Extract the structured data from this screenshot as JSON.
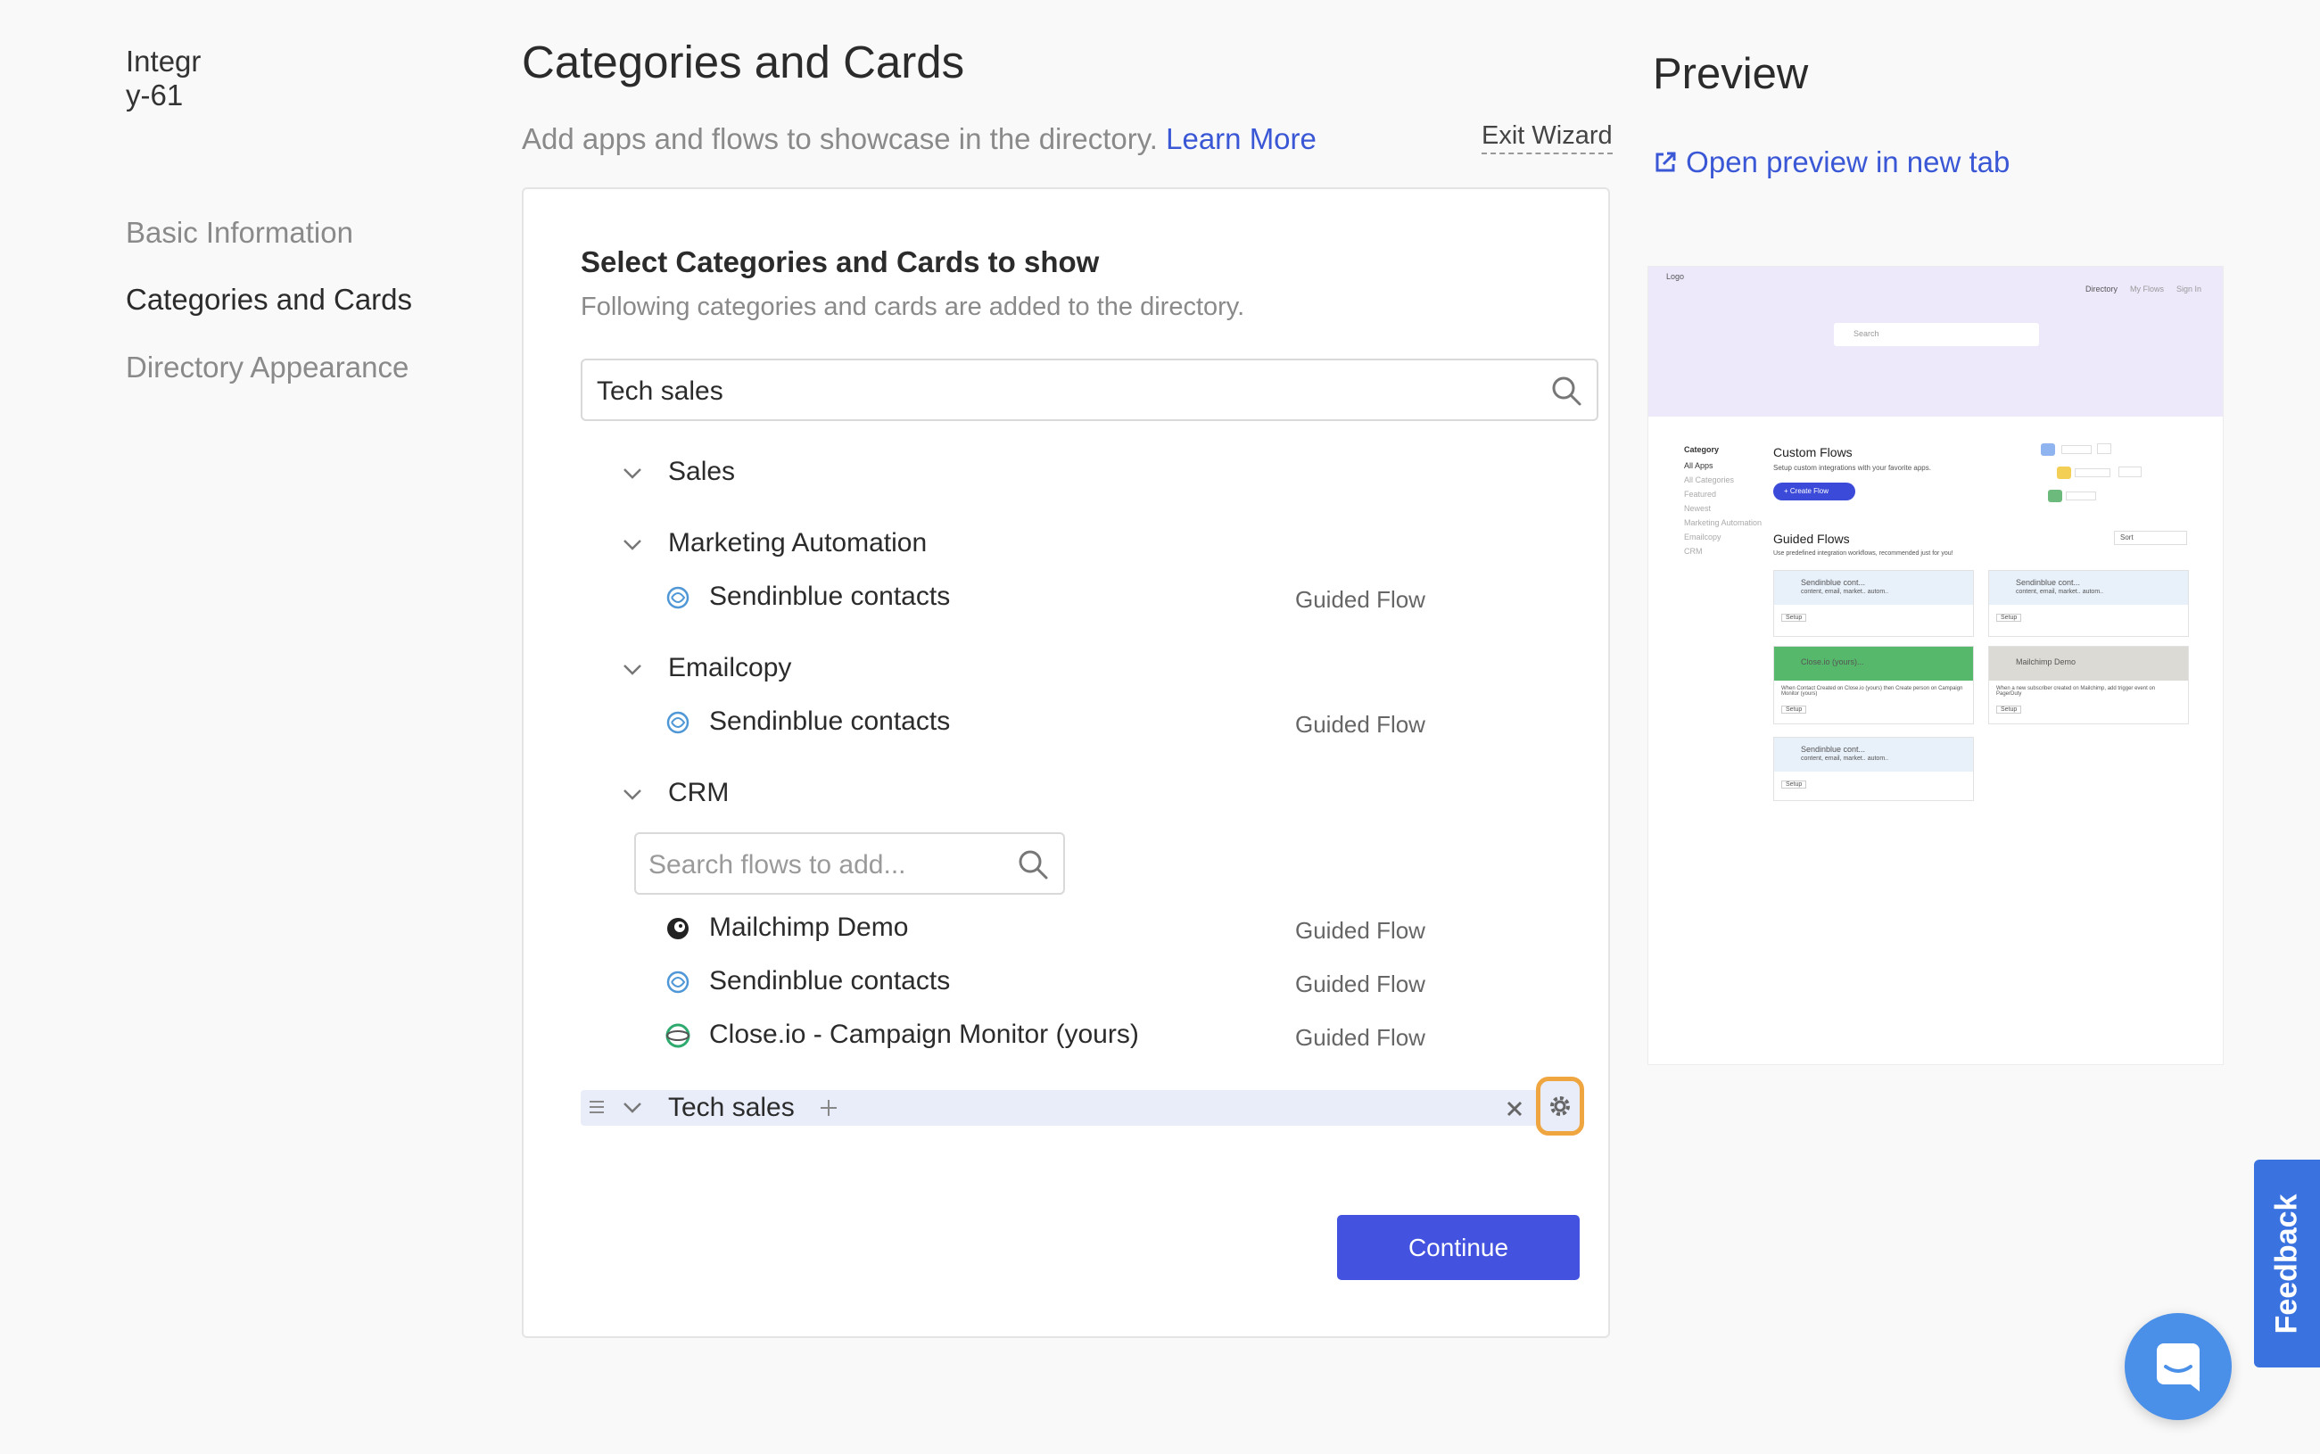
{
  "sidebar": {
    "brand": "Integr\ny-61",
    "items": [
      {
        "label": "Basic Information"
      },
      {
        "label": "Categories and Cards"
      },
      {
        "label": "Directory Appearance"
      }
    ]
  },
  "header": {
    "title": "Categories and Cards",
    "subtitle": "Add apps and flows to showcase in the directory.",
    "learn_more": "Learn More",
    "exit": "Exit Wizard"
  },
  "card": {
    "title": "Select Categories and Cards to show",
    "subtitle": "Following categories and cards are added to the directory.",
    "search_value": "Tech sales",
    "categories": [
      {
        "label": "Sales"
      },
      {
        "label": "Marketing Automation"
      },
      {
        "label": "Emailcopy"
      },
      {
        "label": "CRM"
      }
    ],
    "flows": [
      {
        "name": "Sendinblue contacts",
        "type": "Guided Flow"
      },
      {
        "name": "Sendinblue contacts",
        "type": "Guided Flow"
      },
      {
        "name": "Mailchimp Demo",
        "type": "Guided Flow"
      },
      {
        "name": "Sendinblue contacts",
        "type": "Guided Flow"
      },
      {
        "name": "Close.io - Campaign Monitor (yours)",
        "type": "Guided Flow"
      }
    ],
    "search_flows_placeholder": "Search flows to add...",
    "tech_sales": "Tech sales",
    "continue": "Continue"
  },
  "preview": {
    "title": "Preview",
    "open_link": "Open preview in new tab",
    "mini": {
      "logo": "Logo",
      "nav": [
        "Directory",
        "My Flows",
        "Sign In"
      ],
      "search": "Search",
      "category_heading": "Category",
      "categories": [
        "All Apps",
        "All Categories",
        "Featured",
        "Newest",
        "Marketing Automation",
        "Emailcopy",
        "CRM"
      ],
      "custom_flows": "Custom Flows",
      "custom_sub": "Setup custom integrations with your favorite apps.",
      "create_flow": "+ Create Flow",
      "guided_flows": "Guided Flows",
      "guided_sub": "Use predefined integration workflows, recommended just for you!",
      "sort": "Sort",
      "cards": [
        {
          "title": "Sendinblue cont...",
          "desc": "content, email, market.. autom..",
          "btn": "Setup"
        },
        {
          "title": "Sendinblue cont...",
          "desc": "content, email, market.. autom..",
          "btn": "Setup"
        },
        {
          "title": "Close.io (yours)...",
          "desc": "When Contact Created on Close.io (yours) then Create person on Campaign Monitor (yours)",
          "btn": "Setup"
        },
        {
          "title": "Mailchimp Demo",
          "desc": "When a new subscriber created on Mailchimp, add trigger event on PagerDuty",
          "btn": "Setup"
        },
        {
          "title": "Sendinblue cont...",
          "desc": "content, email, market.. autom..",
          "btn": "Setup"
        }
      ]
    }
  },
  "feedback": "Feedback",
  "colors": {
    "accent": "#4353e0",
    "link": "#3a57d6",
    "highlight": "#f0a640",
    "row_bg": "#e8edf9"
  }
}
